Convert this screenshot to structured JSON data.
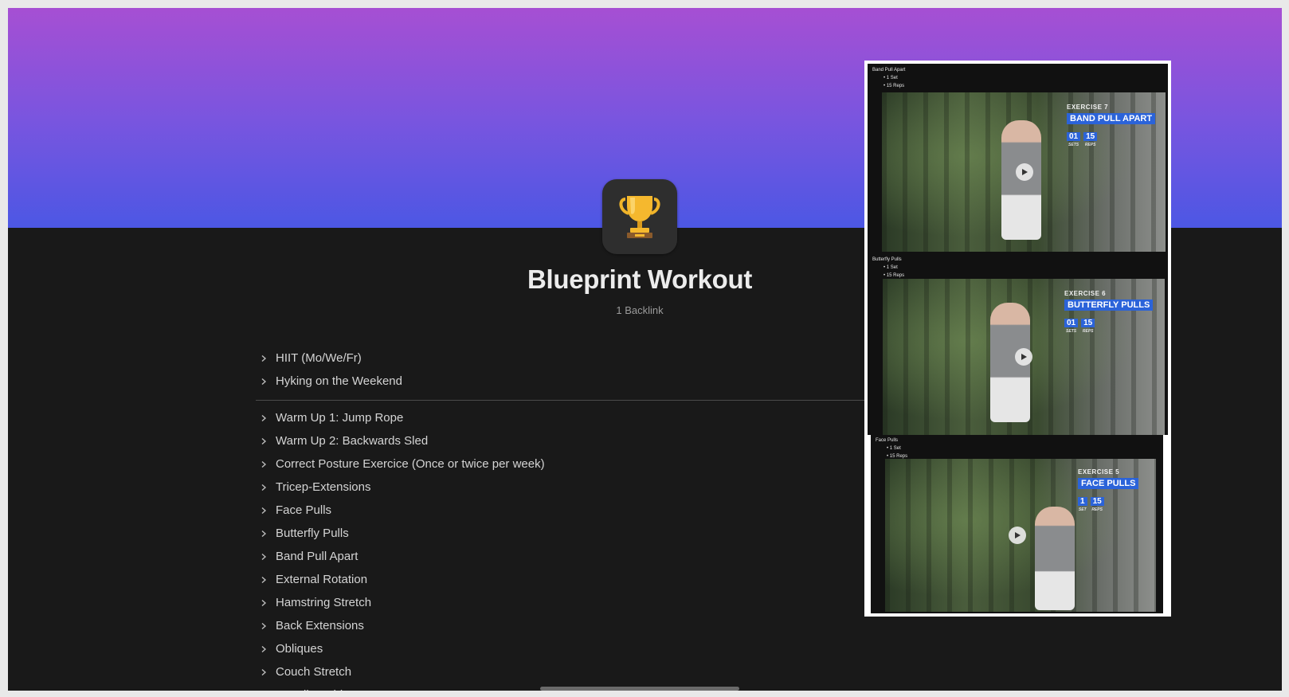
{
  "page": {
    "title": "Blueprint Workout",
    "backlinks": "1 Backlink",
    "icon": "trophy-icon",
    "cover_colors": [
      "#a64fd3",
      "#4c57e4"
    ]
  },
  "list_top": [
    {
      "label": "HIIT (Mo/We/Fr)"
    },
    {
      "label": "Hyking on the Weekend"
    }
  ],
  "list_main": [
    {
      "label": "Warm Up 1: Jump Rope"
    },
    {
      "label": "Warm Up 2: Backwards Sled"
    },
    {
      "label": "Correct Posture Exercice (Once or twice per week)"
    },
    {
      "label": "Tricep-Extensions"
    },
    {
      "label": "Face Pulls"
    },
    {
      "label": "Butterfly Pulls"
    },
    {
      "label": "Band Pull Apart"
    },
    {
      "label": "External Rotation"
    },
    {
      "label": "Hamstring Stretch"
    },
    {
      "label": "Back Extensions"
    },
    {
      "label": "Obliques"
    },
    {
      "label": "Couch Stretch"
    },
    {
      "label": "Kneeling Shin"
    }
  ],
  "embed": {
    "clips": [
      {
        "heading": "Band Pull Apart",
        "sets": "1 Set",
        "reps": "15 Reps",
        "exercise_number": "EXERCISE 7",
        "exercise_name": "BAND PULL APART",
        "sets_value": "01",
        "reps_value": "15",
        "sets_label": "SETS",
        "reps_label": "REPS"
      },
      {
        "heading": "Butterfly Pulls",
        "sets": "1 Set",
        "reps": "15 Reps",
        "exercise_number": "EXERCISE 6",
        "exercise_name": "BUTTERFLY PULLS",
        "sets_value": "01",
        "reps_value": "15",
        "sets_label": "SETS",
        "reps_label": "REPS"
      },
      {
        "heading": "Face Pulls",
        "sets": "1 Set",
        "reps": "15 Reps",
        "exercise_number": "EXERCISE 5",
        "exercise_name": "FACE PULLS",
        "sets_value": "1",
        "reps_value": "15",
        "sets_label": "SET",
        "reps_label": "REPS"
      }
    ]
  }
}
